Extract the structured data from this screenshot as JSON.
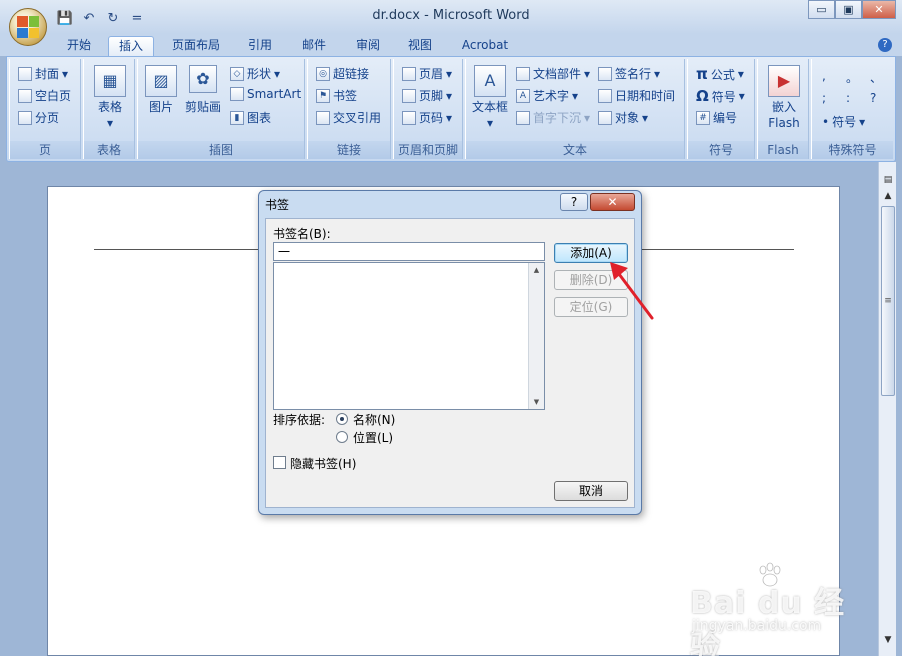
{
  "window": {
    "title": "dr.docx - Microsoft Word",
    "minimize": "▭",
    "restore": "▣",
    "close": "✕"
  },
  "qat": {
    "save": "💾",
    "undo": "↶",
    "redo": "↻",
    "more": "="
  },
  "tabs": [
    "开始",
    "插入",
    "页面布局",
    "引用",
    "邮件",
    "审阅",
    "视图",
    "Acrobat"
  ],
  "active_tab": "插入",
  "help": "?",
  "ribbon": {
    "page_group": {
      "name": "页",
      "items": [
        "封面",
        "空白页",
        "分页"
      ]
    },
    "table_group": {
      "name": "表格",
      "button": "表格"
    },
    "illus_group": {
      "name": "插图",
      "picture": "图片",
      "clipart": "剪贴画",
      "shapes": "形状",
      "smartart": "SmartArt",
      "chart": "图表"
    },
    "link_group": {
      "name": "链接",
      "items": [
        "超链接",
        "书签",
        "交叉引用"
      ]
    },
    "hf_group": {
      "name": "页眉和页脚",
      "items": [
        "页眉",
        "页脚",
        "页码"
      ]
    },
    "text_group": {
      "name": "文本",
      "textbox": "文本框",
      "parts": "文档部件",
      "wordart": "艺术字",
      "dropcap": "首字下沉",
      "signature": "签名行",
      "datetime": "日期和时间",
      "object": "对象"
    },
    "symbol_group": {
      "name": "符号",
      "equation": "公式",
      "symbol": "符号",
      "number": "编号"
    },
    "flash_group": {
      "name": "Flash",
      "embed": "嵌入",
      "flash": "Flash"
    },
    "special_group": {
      "name": "特殊符号",
      "symbol": "符号",
      "chars": [
        ",",
        "。",
        "、",
        ";",
        ":",
        "?"
      ]
    }
  },
  "dialog": {
    "title": "书签",
    "help_btn": "?",
    "close_btn": "✕",
    "name_label": "书签名(B):",
    "name_value": "一",
    "add": "添加(A)",
    "delete": "删除(D)",
    "goto": "定位(G)",
    "sort_label": "排序依据:",
    "sort_name": "名称(N)",
    "sort_pos": "位置(L)",
    "hidden": "隐藏书签(H)",
    "cancel": "取消"
  },
  "watermark": {
    "brand": "Bai du 经验",
    "url": "jingyan.baidu.com"
  },
  "colors": {
    "accent_red": "#e0202a",
    "ribbon_text": "#15428b"
  }
}
